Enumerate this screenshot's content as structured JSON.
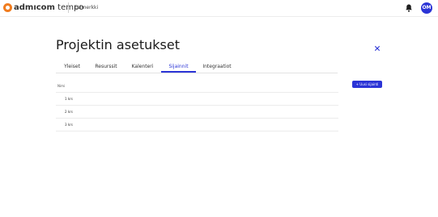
{
  "header": {
    "logo_bold": "admıcom",
    "logo_light": "tempo",
    "project_name": "Esimerkki",
    "user_initials": "OM"
  },
  "page": {
    "title": "Projektin asetukset"
  },
  "tabs": [
    {
      "label": "Yleiset",
      "active": false
    },
    {
      "label": "Resurssit",
      "active": false
    },
    {
      "label": "Kalenteri",
      "active": false
    },
    {
      "label": "Sijainnit",
      "active": true
    },
    {
      "label": "Integraatiot",
      "active": false
    }
  ],
  "locations": {
    "new_button_label": "+ Uusi sijainti",
    "column_name": "Nimi",
    "rows": [
      "1 krs",
      "2 krs",
      "3 krs"
    ]
  },
  "colors": {
    "accent": "#2b34d6",
    "brand": "#f07c1f"
  },
  "icons": {
    "notifications": "bell-icon",
    "close": "close-icon"
  }
}
